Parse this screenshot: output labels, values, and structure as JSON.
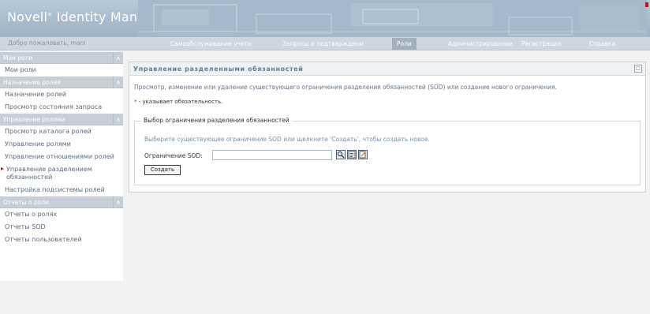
{
  "header": {
    "brand": "Novell",
    "brand_mark": "®",
    "brand_product": " Identity Manager"
  },
  "navbar": {
    "welcome": "Добро пожаловать, mani",
    "tabs": [
      {
        "label": "Самообслуживание учетн",
        "active": false
      },
      {
        "label": "Запросы и подтверждени",
        "active": false
      },
      {
        "label": "Роли",
        "active": true
      },
      {
        "label": "Администрирование",
        "active": false
      },
      {
        "label": "Регистрация",
        "active": false
      },
      {
        "label": "Справка",
        "active": false
      }
    ]
  },
  "sidebar": {
    "sections": [
      {
        "title": "Мои роли",
        "items": [
          {
            "label": "Мои роли"
          }
        ]
      },
      {
        "title": "Назначение ролей",
        "items": [
          {
            "label": "Назначение ролей"
          },
          {
            "label": "Просмотр состояния запроса"
          }
        ]
      },
      {
        "title": "Управление ролями",
        "items": [
          {
            "label": "Просмотр каталога ролей"
          },
          {
            "label": "Управление ролями"
          },
          {
            "label": "Управление отношениями ролей"
          },
          {
            "label": "Управление разделением обязанностей",
            "active": true
          },
          {
            "label": "Настройка подсистемы ролей"
          }
        ]
      },
      {
        "title": "Отчеты о роли",
        "items": [
          {
            "label": "Отчеты о ролях"
          },
          {
            "label": "Отчеты SOD"
          },
          {
            "label": "Отчеты пользователей"
          }
        ]
      }
    ]
  },
  "main": {
    "title": "Управление разделенными обязанностей",
    "intro": "Просмотр, изменение или удаление существующего ограничения разделения обязанностей (SOD) или создание нового ограничения.",
    "required_star": "*",
    "required_note": " - указывает обязательность.",
    "fieldset_legend": "Выбор ограничения разделения обязанностей",
    "help_text": "Выберите существующее ограничение SOD или щелкните 'Создать', чтобы создать новое.",
    "sod_label": "Ограничение SOD:",
    "sod_value": "",
    "create_button": "Создать"
  },
  "colors": {
    "header": "#a9bccc",
    "sidebar_header": "#c6ced7",
    "accent_red": "#c0161a",
    "link_blue": "#7690ac"
  }
}
